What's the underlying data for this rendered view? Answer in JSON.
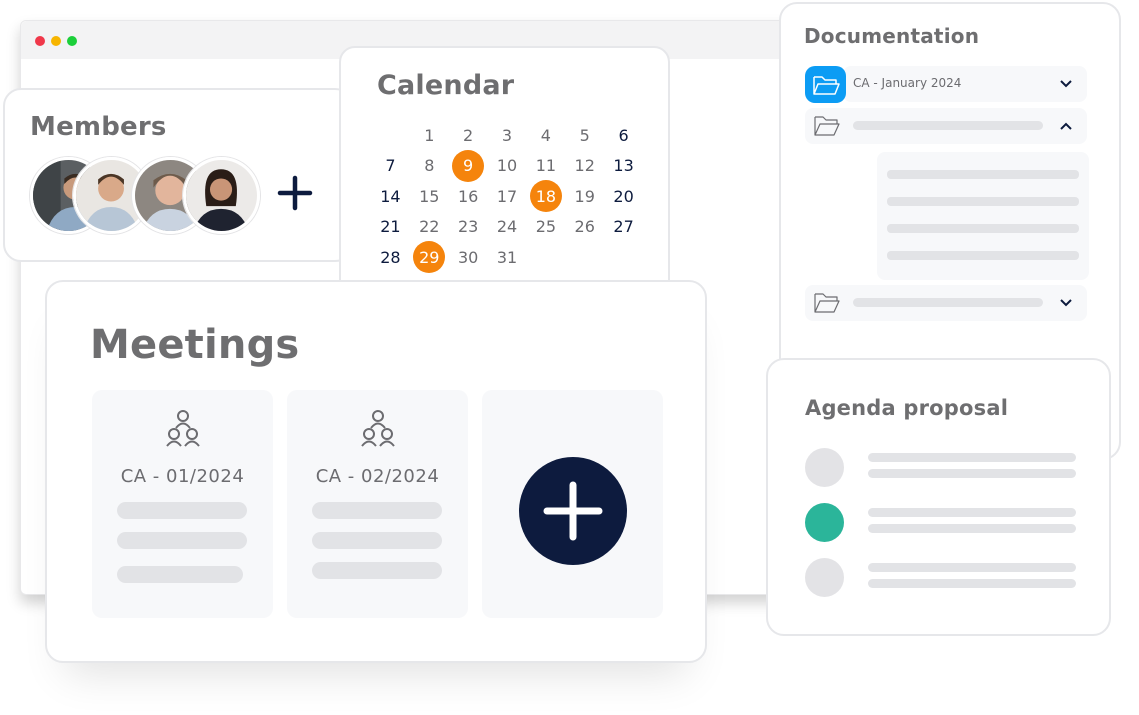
{
  "colors": {
    "accent_orange": "#f5840c",
    "navy": "#0d1b3e",
    "folder_blue": "#0c9cf4",
    "agenda_green": "#2bb59a",
    "placeholder_gray": "#e2e3e6",
    "window_red": "#f0384a",
    "window_yellow": "#f7b500",
    "window_green": "#1ccf3a"
  },
  "browser": {
    "controls": [
      "close",
      "minimize",
      "maximize"
    ]
  },
  "members": {
    "title": "Members",
    "avatars": [
      {
        "name": "member-1",
        "description": "man with beard in blue shirt"
      },
      {
        "name": "member-2",
        "description": "smiling man in light blue shirt"
      },
      {
        "name": "member-3",
        "description": "smiling older woman"
      },
      {
        "name": "member-4",
        "description": "smiling woman with dark hair"
      }
    ],
    "add_icon": "plus-icon"
  },
  "calendar": {
    "title": "Calendar",
    "weeks": [
      [
        null,
        1,
        2,
        3,
        4,
        5,
        6
      ],
      [
        7,
        8,
        9,
        10,
        11,
        12,
        13
      ],
      [
        14,
        15,
        16,
        17,
        18,
        19,
        20
      ],
      [
        21,
        22,
        23,
        24,
        25,
        26,
        27
      ],
      [
        28,
        29,
        30,
        31,
        null,
        null,
        null
      ]
    ],
    "highlighted_days": [
      9,
      18,
      29
    ],
    "weekend_columns": [
      0,
      6
    ]
  },
  "documentation": {
    "title": "Documentation",
    "folders": [
      {
        "label": "CA - January 2024",
        "active": true,
        "expanded": false,
        "chevron": "chevron-down-icon"
      },
      {
        "label": "",
        "active": false,
        "expanded": true,
        "chevron": "chevron-up-icon",
        "subitems": 4
      },
      {
        "label": "",
        "active": false,
        "expanded": false,
        "chevron": "chevron-down-icon"
      }
    ]
  },
  "meetings": {
    "title": "Meetings",
    "items": [
      {
        "label": "CA - 01/2024",
        "icon": "people-group-icon"
      },
      {
        "label": "CA - 02/2024",
        "icon": "people-group-icon"
      }
    ],
    "add_icon": "plus-circle-icon"
  },
  "agenda": {
    "title": "Agenda proposal",
    "items": [
      {
        "status": "pending"
      },
      {
        "status": "active"
      },
      {
        "status": "pending"
      }
    ]
  }
}
